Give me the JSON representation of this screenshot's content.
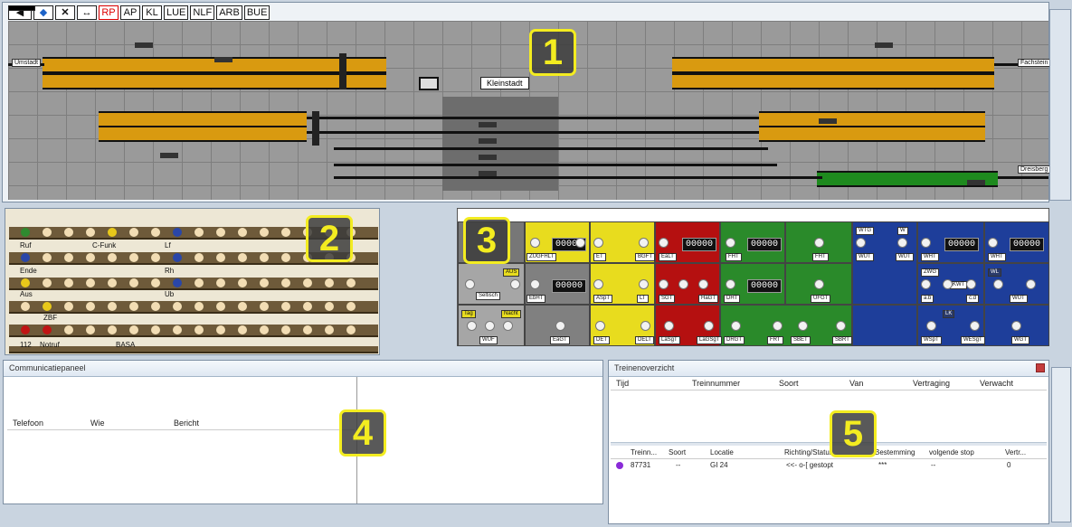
{
  "toolbar": {
    "buttons": [
      "RP",
      "AP",
      "KL",
      "LUE",
      "NLF",
      "ARB",
      "BUE"
    ]
  },
  "panel1": {
    "station_label": "Kleinstadt",
    "left_end_label": "Umstadt",
    "right_end_label": "Fachstein",
    "right_lower_label": "Dreisberg"
  },
  "badges": [
    "1",
    "2",
    "3",
    "4",
    "5"
  ],
  "panel2": {
    "labels": {
      "ruf": "Ruf",
      "cfunk": "C-Funk",
      "lf": "Lf",
      "ende": "Ende",
      "rh": "Rh",
      "aus": "Aus",
      "ub": "Ub",
      "zbf": "ZBF",
      "n112": "112",
      "notruf": "Notruf",
      "basa": "BASA"
    }
  },
  "panel3": {
    "counter": "00000",
    "tags": {
      "zugfhlt": "ZUGFHLT",
      "et": "ET",
      "bgft": "BGFT",
      "ealt": "EaLT",
      "fht": "FHT",
      "fhtb": "FHT",
      "wtg": "WTG",
      "w": "W",
      "wut": "WUT",
      "wut2": "WUT",
      "wht": "WHT",
      "wht2": "WHT",
      "aus": "AUS",
      "seltisch": "Seltisch",
      "ebht": "EbHT",
      "aspt": "ASpT",
      "lt": "LT",
      "sgt": "SGT",
      "hagt": "HaGT",
      "dht": "DHT",
      "ufgt": "UFGT",
      "zwg": "ZWG",
      "kwt": "KWT",
      "ab": "a.b",
      "cd": "c.d",
      "wl": "WL",
      "wut3": "WUT",
      "tag": "Tag",
      "nacht": "Nacht",
      "wuf": "WUF",
      "ealt2": "EaGT",
      "det": "DET",
      "delt": "DELT",
      "lasgt": "LaSgT",
      "lagt": "LaGSgT",
      "drgt": "DRGT",
      "frt": "FRT",
      "sbet": "SBET",
      "sbrt": "SBRT",
      "lk": "LK",
      "wspt": "WSpT",
      "wesgt": "WESgT",
      "wgt": "WGT"
    },
    "colors": {
      "gray": "#a6a6a6",
      "darkgray": "#808080",
      "yellow": "#e8dc1e",
      "red": "#b51010",
      "green": "#2a8a2a",
      "blue": "#1e3e9a"
    }
  },
  "communicatie": {
    "title": "Communicatiepaneel",
    "columns": [
      "Telefoon",
      "Wie",
      "Bericht"
    ]
  },
  "treinen": {
    "title": "Treinenoverzicht",
    "top_columns": [
      "Tijd",
      "Treinnummer",
      "Soort",
      "Van",
      "Vertraging",
      "Verwacht"
    ],
    "bottom_columns": [
      "Treinn...",
      "Soort",
      "Locatie",
      "Richting/Status",
      "Bestemming",
      "volgende stop",
      "Vertr..."
    ],
    "rows": [
      {
        "treinnummer": "87731",
        "soort": "--",
        "locatie": "GI 24",
        "status": "<<- o-[ gestopt",
        "bestemming": "***",
        "volgende": "--",
        "vertraging": "0"
      }
    ]
  }
}
